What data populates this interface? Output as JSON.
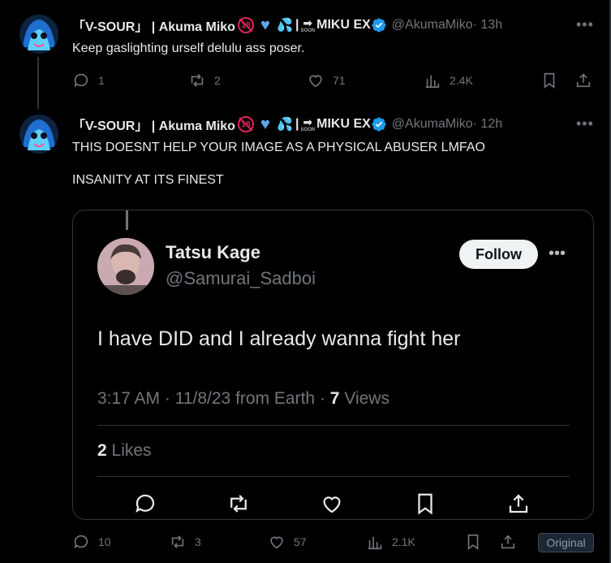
{
  "tweets": [
    {
      "display_name": "「V-SOUR」 | Akuma Miko",
      "name_suffix": "MIKU EX",
      "soon_label": "SOON",
      "restricted_label": "18",
      "handle": "@AkumaMiko",
      "time": "· 13h",
      "text": "Keep gaslighting urself delulu ass poser.",
      "replies": "1",
      "reposts": "2",
      "likes": "71",
      "views": "2.4K"
    },
    {
      "display_name": "「V-SOUR」 | Akuma Miko",
      "name_suffix": "MIKU EX",
      "soon_label": "SOON",
      "restricted_label": "18",
      "handle": "@AkumaMiko",
      "time": "· 12h",
      "text": "THIS DOESNT HELP YOUR IMAGE AS A PHYSICAL ABUSER LMFAO\n\nINSANITY AT ITS FINEST",
      "replies": "10",
      "reposts": "3",
      "likes": "57",
      "views": "2.1K"
    }
  ],
  "quote": {
    "name": "Tatsu Kage",
    "handle": "@Samurai_Sadboi",
    "follow_label": "Follow",
    "text": "I have DID and I already wanna fight her",
    "time": "3:17 AM",
    "date": "11/8/23 from Earth",
    "views_count": "7",
    "views_label": "Views",
    "likes_count": "2",
    "likes_label": "Likes"
  },
  "badge": {
    "label": "Original"
  },
  "colors": {
    "background": "#000000",
    "muted": "#71767b",
    "verified": "#1d9bf0",
    "follow_bg": "#eff3f4"
  },
  "icons": [
    "reply-icon",
    "repost-icon",
    "like-icon",
    "views-icon",
    "bookmark-icon",
    "share-icon",
    "verified-icon",
    "more-icon"
  ]
}
